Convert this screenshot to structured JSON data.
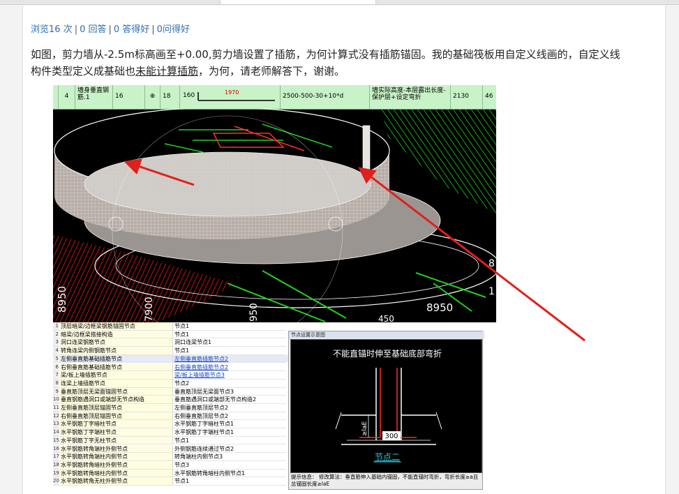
{
  "stats": {
    "views": "浏览16 次",
    "answers": "0 回答",
    "good_answers": "0 答得好",
    "good_questions": "0问得好",
    "separator": "|"
  },
  "question": {
    "part1": "如图，剪力墙从-2.5m标高画至+0.00,剪力墙设置了插筋，为何计算式没有插筋锚固。我的基础筏板用自定义线画的，自定义线构件类型定义成基础也",
    "underlined": "未能计算插筋",
    "part2": "，为何，请老师解答下，谢谢。"
  },
  "rebar_row": {
    "index": "4",
    "name": "墙身垂直钢筋.1",
    "diameter": "16",
    "grade": "⊕",
    "code": "18",
    "shape_code": "160",
    "shape_length": "1970",
    "formula": "2500-500-30+10*d",
    "description": "墙实际高度-本层露出长度-保护层+设定弯折",
    "length": "2130",
    "count": "46"
  },
  "cad_labels": {
    "dim1": "8950",
    "dim2": "8950",
    "dim3": "7900",
    "dim4": "950",
    "dim5": "450",
    "dim6": "8",
    "dim7": "1"
  },
  "settings_table": {
    "rows": [
      {
        "n": "1",
        "k": "顶层暗梁/边框梁钢筋锚固节点",
        "v": "节点1"
      },
      {
        "n": "2",
        "k": "暗梁/边框梁搭接构造",
        "v": "节点1"
      },
      {
        "n": "3",
        "k": "洞口连梁钢筋节点",
        "v": "洞口连梁节点1"
      },
      {
        "n": "4",
        "k": "转角连梁内侧钢筋节点",
        "v": "节点1"
      },
      {
        "n": "5",
        "k": "左侧垂直筋基础插筋节点",
        "v": "左侧垂直筋插筋节点2"
      },
      {
        "n": "6",
        "k": "右侧垂直筋基础插筋节点",
        "v": "右侧垂直筋插筋节点2"
      },
      {
        "n": "7",
        "k": "梁/板上墙插筋节点",
        "v": "梁/板上墙插筋节点3"
      },
      {
        "n": "8",
        "k": "连梁上墙插筋节点",
        "v": "节点2"
      },
      {
        "n": "9",
        "k": "垂直筋顶层无梁面锚固节点",
        "v": "垂直筋顶层无梁面节点3"
      },
      {
        "n": "10",
        "k": "垂直钢筋遇洞口或端部无节点构造",
        "v": "垂直筋遇洞口或端部无节点构造2"
      },
      {
        "n": "11",
        "k": "左侧垂直筋顶层锚固节点",
        "v": "左侧垂直筋顶层节点2"
      },
      {
        "n": "12",
        "k": "右侧垂直筋顶层锚固节点",
        "v": "右侧垂直筋顶层节点2"
      },
      {
        "n": "13",
        "k": "水平钢筋丁字暗柱节点",
        "v": "水平钢筋丁字暗柱节点1"
      },
      {
        "n": "14",
        "k": "水平钢筋丁字端柱节点",
        "v": "水平钢筋丁字端柱节点1"
      },
      {
        "n": "15",
        "k": "水平钢筋丁字无柱节点",
        "v": "节点1"
      },
      {
        "n": "16",
        "k": "水平钢筋转角端柱外侧节点",
        "v": "外侧钢筋连续通过节点2"
      },
      {
        "n": "17",
        "k": "水平钢筋转角端柱内侧节点",
        "v": "转角端柱内侧节点3"
      },
      {
        "n": "18",
        "k": "水平钢筋转角暗柱外侧节点",
        "v": "节点3"
      },
      {
        "n": "19",
        "k": "水平钢筋转角暗柱内侧节点",
        "v": "水平钢筋转角暗柱内侧节点1"
      },
      {
        "n": "20",
        "k": "水平钢筋转角无柱外侧节点",
        "v": "节点1"
      }
    ]
  },
  "node_panel": {
    "title": "节点设置示意图",
    "heading": "不能直锚时伸至基础底部弯折",
    "dim_le": "≥laE",
    "dim_300": "300",
    "node_link": "节点二",
    "tip": "提示信息： 修改算法：垂直筋伸入基础内锚固，不能直锚时弯折，弯折长度≥a且总锚固长度≥laE"
  },
  "colors": {
    "link": "#2d6fb2",
    "strip_bg": "#c8f2c8",
    "arrow": "#e0201c"
  }
}
